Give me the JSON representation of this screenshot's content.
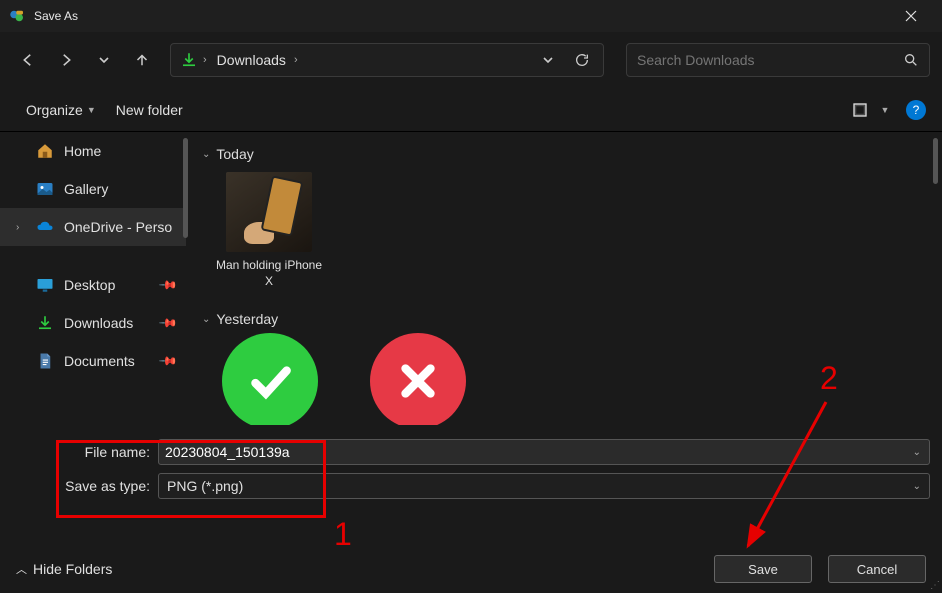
{
  "window": {
    "title": "Save As"
  },
  "nav": {
    "path_current": "Downloads",
    "search_placeholder": "Search Downloads"
  },
  "toolbar": {
    "organize": "Organize",
    "new_folder": "New folder"
  },
  "sidebar": {
    "home": "Home",
    "gallery": "Gallery",
    "onedrive": "OneDrive - Perso",
    "desktop": "Desktop",
    "downloads": "Downloads",
    "documents": "Documents"
  },
  "content": {
    "groups": [
      {
        "label": "Today",
        "items": [
          {
            "name": "Man holding iPhone X"
          }
        ]
      },
      {
        "label": "Yesterday",
        "items": []
      }
    ]
  },
  "form": {
    "filename_label": "File name:",
    "filename_value": "20230804_150139a",
    "type_label": "Save as type:",
    "type_value": "PNG (*.png)"
  },
  "footer": {
    "hide_folders": "Hide Folders",
    "save": "Save",
    "cancel": "Cancel"
  },
  "annotations": {
    "num1": "1",
    "num2": "2"
  }
}
